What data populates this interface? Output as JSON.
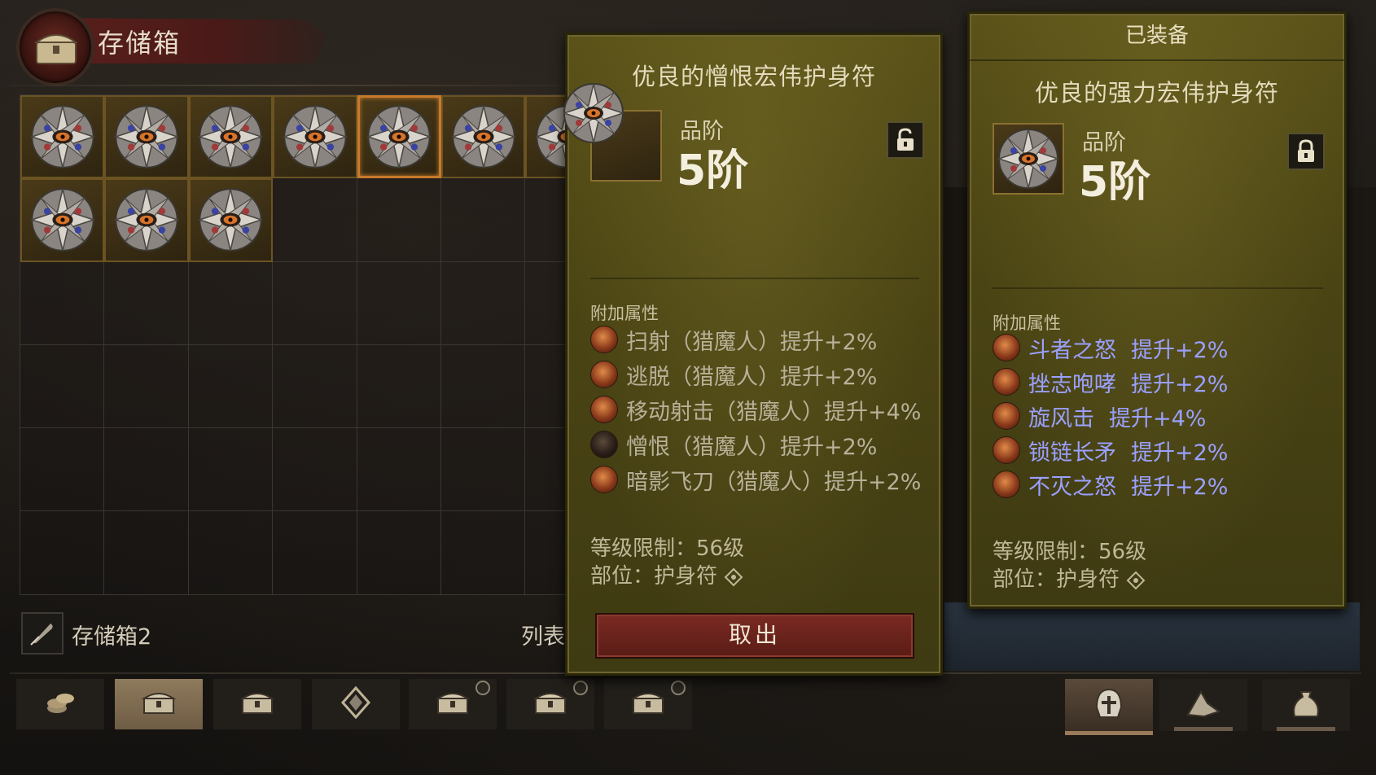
{
  "header": {
    "title": "存储箱"
  },
  "grid": {
    "rows": 6,
    "cols": 7,
    "filled_count": 10,
    "selected_index": 4
  },
  "storage": {
    "name": "存储箱2",
    "list_label": "列表"
  },
  "tooltip_left": {
    "title": "优良的憎恨宏伟护身符",
    "grade_label": "品阶",
    "grade_value": "5阶",
    "lock_state": "unlocked",
    "attr_header": "附加属性",
    "attributes": [
      {
        "icon": "strafe-icon",
        "text": "扫射（猎魔人）提升+2%"
      },
      {
        "icon": "vault-icon",
        "text": "逃脱（猎魔人）提升+2%"
      },
      {
        "icon": "multishot-icon",
        "text": "移动射击（猎魔人）提升+4%"
      },
      {
        "icon": "hatred-icon",
        "text": "憎恨（猎魔人）提升+2%"
      },
      {
        "icon": "shadow-knife-icon",
        "text": "暗影飞刀（猎魔人）提升+2%"
      }
    ],
    "level_req": "等级限制：56级",
    "slot": "部位：护身符",
    "withdraw_label": "取出"
  },
  "tooltip_right": {
    "equipped_label": "已装备",
    "title": "优良的强力宏伟护身符",
    "grade_label": "品阶",
    "grade_value": "5阶",
    "lock_state": "locked",
    "attr_header": "附加属性",
    "attributes": [
      {
        "icon": "wrath-icon",
        "skill": "斗者之怒",
        "bonus": "提升+2%"
      },
      {
        "icon": "war-cry-icon",
        "skill": "挫志咆哮",
        "bonus": "提升+2%"
      },
      {
        "icon": "whirlwind-icon",
        "skill": "旋风击",
        "bonus": "提升+4%"
      },
      {
        "icon": "chain-spear-icon",
        "skill": "锁链长矛",
        "bonus": "提升+2%"
      },
      {
        "icon": "undying-rage-icon",
        "skill": "不灭之怒",
        "bonus": "提升+2%"
      }
    ],
    "level_req": "等级限制：56级",
    "slot": "部位：护身符"
  },
  "bottom_tabs": [
    {
      "icon": "gold-coins-icon",
      "active": false,
      "locked": false
    },
    {
      "icon": "chest-icon",
      "active": true,
      "locked": false
    },
    {
      "icon": "chest-icon",
      "active": false,
      "locked": false
    },
    {
      "icon": "gem-icon",
      "active": false,
      "locked": false
    },
    {
      "icon": "chest-icon",
      "active": false,
      "locked": true
    },
    {
      "icon": "chest-icon",
      "active": false,
      "locked": true
    },
    {
      "icon": "chest-icon",
      "active": false,
      "locked": true
    }
  ],
  "equipment_tabs": [
    {
      "icon": "helmet-icon",
      "active": true
    },
    {
      "icon": "gear-pieces-icon",
      "active": false
    },
    {
      "icon": "bag-icon",
      "active": false
    }
  ],
  "colors": {
    "panel": "#4a4414",
    "selected_border": "#c77a2a",
    "bonus_blue": "#9aa0ff",
    "withdraw_button": "#7a2a22"
  }
}
